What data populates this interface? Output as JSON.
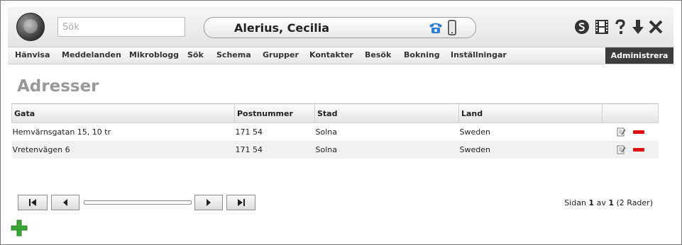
{
  "header": {
    "search_placeholder": "Sök",
    "user_name": "Alerius, Cecilia",
    "icons": [
      "globe-logo",
      "phone-icon",
      "mobile-icon",
      "skype-icon",
      "film-icon",
      "help-icon",
      "download-icon",
      "close-icon"
    ]
  },
  "nav": {
    "items": [
      "Hänvisa",
      "Meddelanden",
      "Mikroblogg",
      "Sök",
      "Schema",
      "Grupper",
      "Kontakter",
      "Besök",
      "Bokning",
      "Inställningar"
    ],
    "admin_label": "Administrera"
  },
  "page": {
    "title": "Adresser"
  },
  "table": {
    "columns": [
      "Gata",
      "Postnummer",
      "Stad",
      "Land",
      ""
    ],
    "rows": [
      [
        "Hemvärnsgatan 15, 10 tr",
        "171 54",
        "Solna",
        "Sweden"
      ],
      [
        "Vretenvägen 6",
        "171 54",
        "Solna",
        "Sweden"
      ]
    ]
  },
  "pager": {
    "page_label": "Sidan",
    "page_current": "1",
    "of_label": "av",
    "page_total": "1",
    "rows_info": "(2 Rader)"
  },
  "colors": {
    "admin_bg": "#3d3d3d",
    "delete": "#dd1111",
    "add": "#3aa635",
    "phone": "#2e7fd1"
  }
}
